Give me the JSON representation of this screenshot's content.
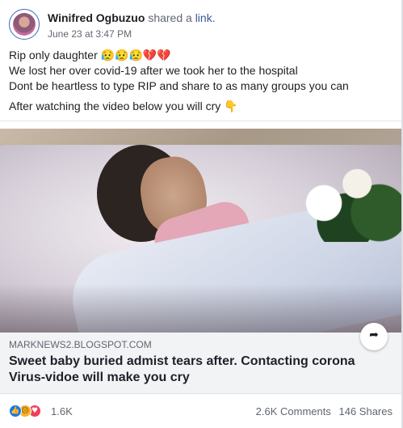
{
  "post": {
    "author": "Winifred Ogbuzuo",
    "shared_text": "shared a",
    "link_text": "link.",
    "timestamp": "June 23 at 3:47 PM",
    "message_lines": [
      "Rip only daughter 😥😥😥💔💔",
      "We lost her over covid-19 after we took her to the hospital",
      "Dont be heartless to type RIP and share to as many groups you can",
      "After watching the video below you will cry 👇"
    ]
  },
  "link_preview": {
    "domain": "MARKNEWS2.BLOGSPOT.COM",
    "title": "Sweet baby buried admist tears after. Contacting corona Virus-vidoe will make you cry"
  },
  "footer": {
    "reaction_count": "1.6K",
    "comments": "2.6K Comments",
    "shares": "146 Shares",
    "reaction_icons": [
      "like-icon",
      "sad-icon",
      "love-icon"
    ]
  },
  "icons": {
    "share": "share-icon"
  },
  "colors": {
    "link": "#385898",
    "like": "#1877f2",
    "love": "#f33e58",
    "sad": "#f7b125"
  }
}
